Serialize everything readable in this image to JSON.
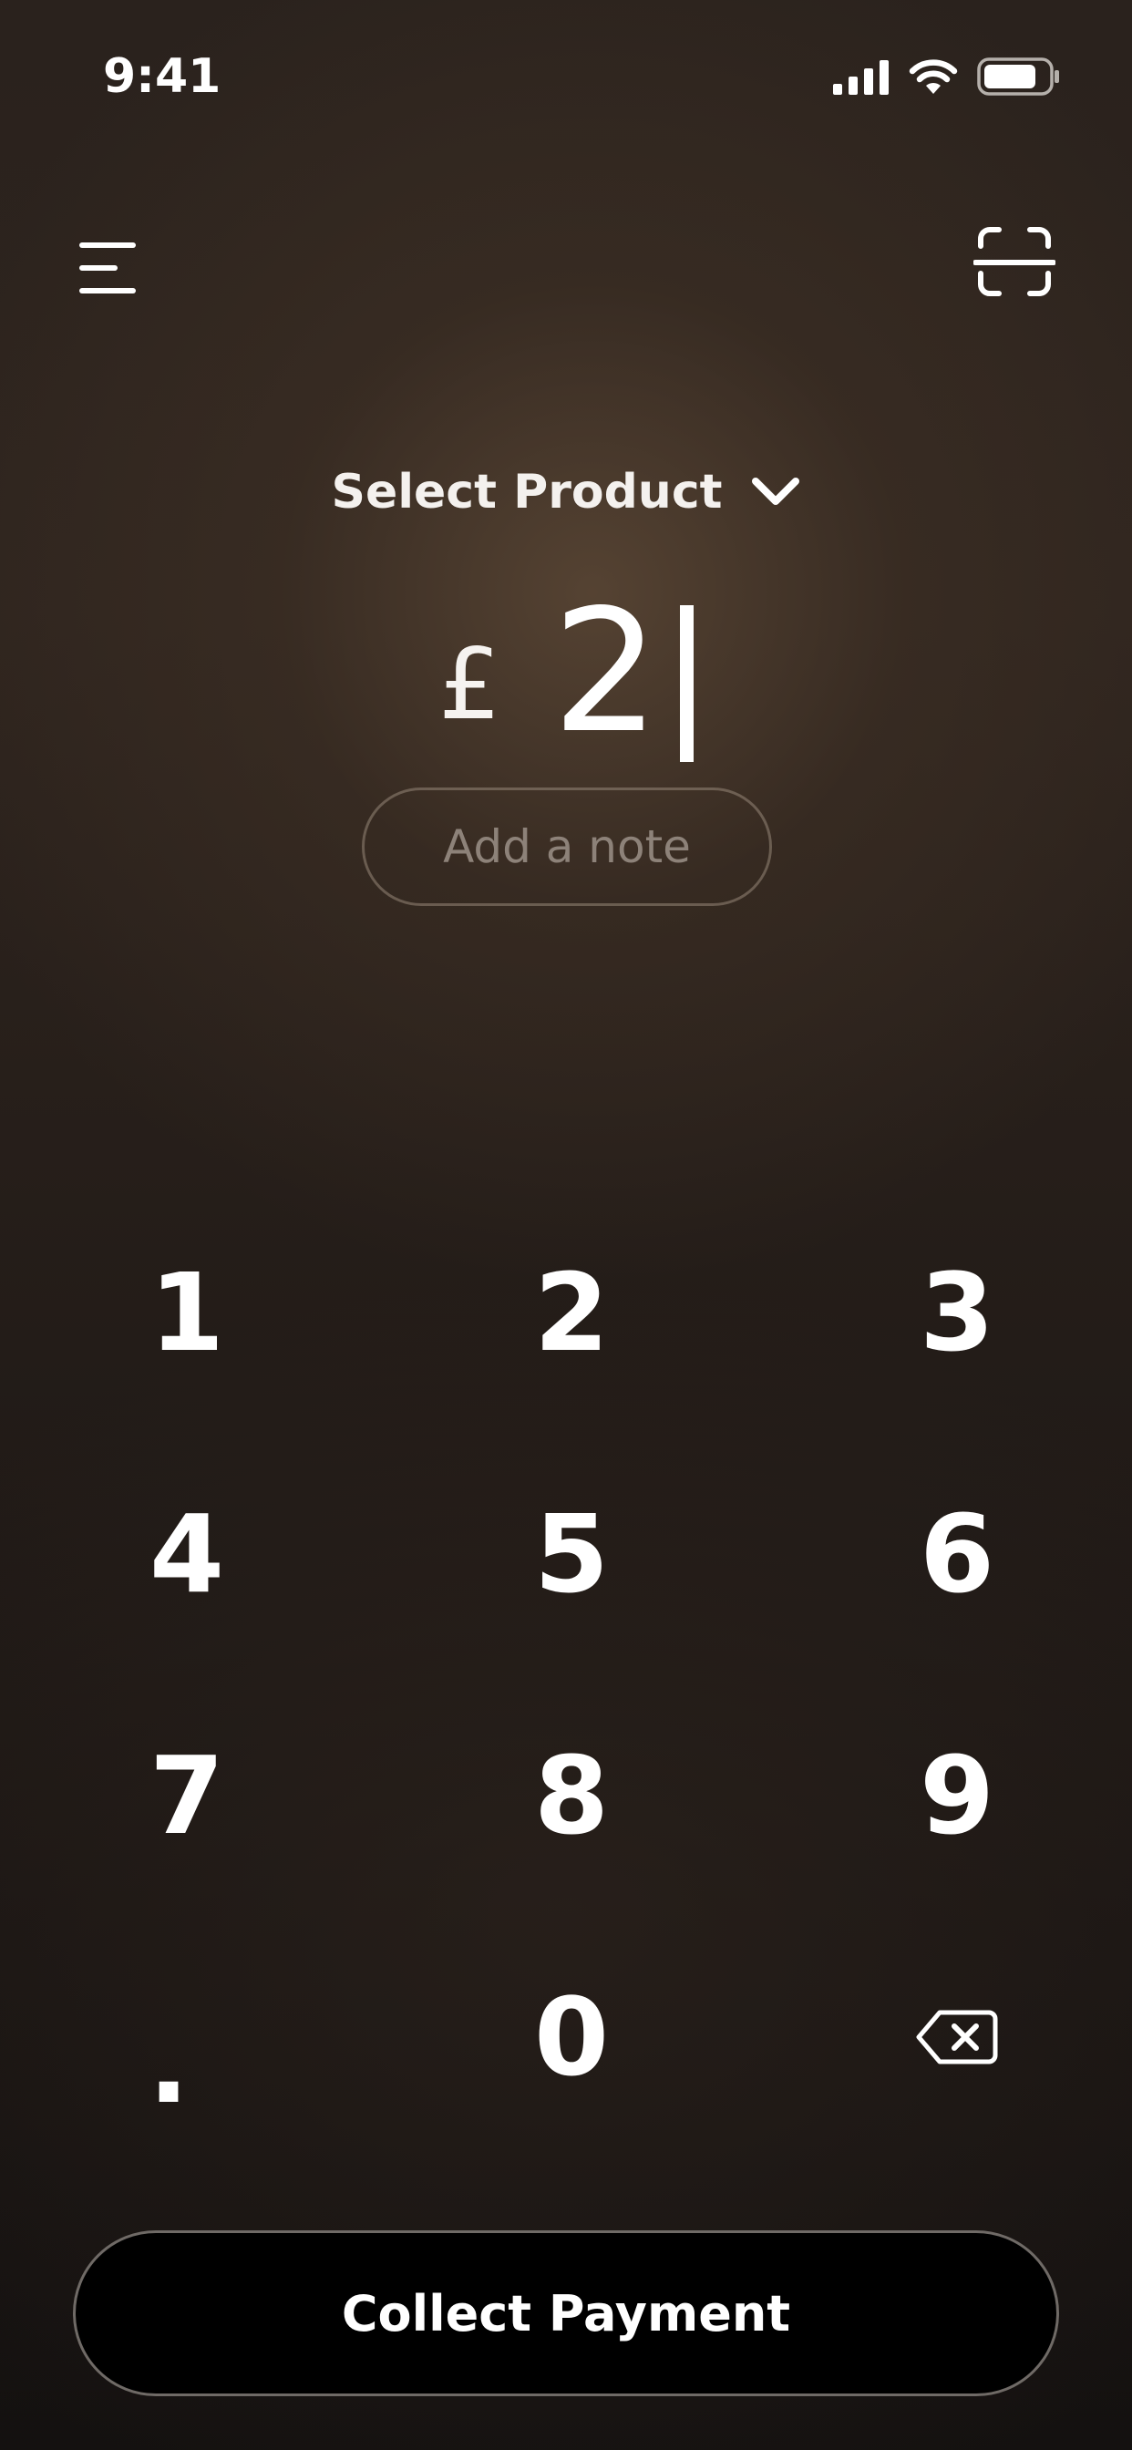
{
  "status_bar": {
    "time": "9:41",
    "icons": [
      "signal-icon",
      "wifi-icon",
      "battery-icon"
    ]
  },
  "header": {
    "menu_icon": "hamburger-menu-icon",
    "scan_icon": "scan-icon"
  },
  "product_select": {
    "label": "Select Product",
    "icon": "chevron-down-icon"
  },
  "amount": {
    "currency_symbol": "£",
    "value": "2"
  },
  "note": {
    "placeholder": "Add a note"
  },
  "keypad": {
    "keys": [
      "1",
      "2",
      "3",
      "4",
      "5",
      "6",
      "7",
      "8",
      "9",
      ".",
      "0"
    ],
    "backspace_icon": "backspace-icon"
  },
  "collect_button": {
    "label": "Collect Payment"
  },
  "colors": {
    "background": "#2a221d",
    "button_background": "#000000",
    "text": "#ffffff",
    "note_text": "#8d8279"
  }
}
